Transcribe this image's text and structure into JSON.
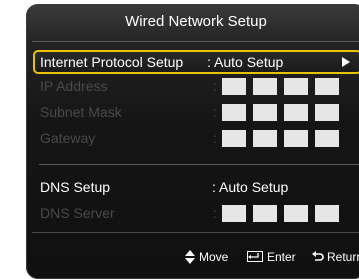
{
  "dialog": {
    "title": "Wired Network Setup"
  },
  "rows": [
    {
      "label": "Internet Protocol Setup",
      "value": ": Auto Setup"
    },
    {
      "label": "IP Address",
      "colon": ":"
    },
    {
      "label": "Subnet Mask",
      "colon": ":"
    },
    {
      "label": "Gateway",
      "colon": ":"
    },
    {
      "label": "DNS Setup",
      "value": ": Auto Setup"
    },
    {
      "label": "DNS Server",
      "colon": ":"
    }
  ],
  "footer": {
    "move_label": "Move",
    "enter_label": "Enter",
    "return_label": "Return"
  },
  "colors": {
    "highlight": "#e8c400",
    "address_box": "#e6e6e6",
    "disabled_text": "#4a4a4a"
  },
  "icons": [
    "right-arrow-icon",
    "move-icon",
    "enter-icon",
    "return-icon"
  ]
}
